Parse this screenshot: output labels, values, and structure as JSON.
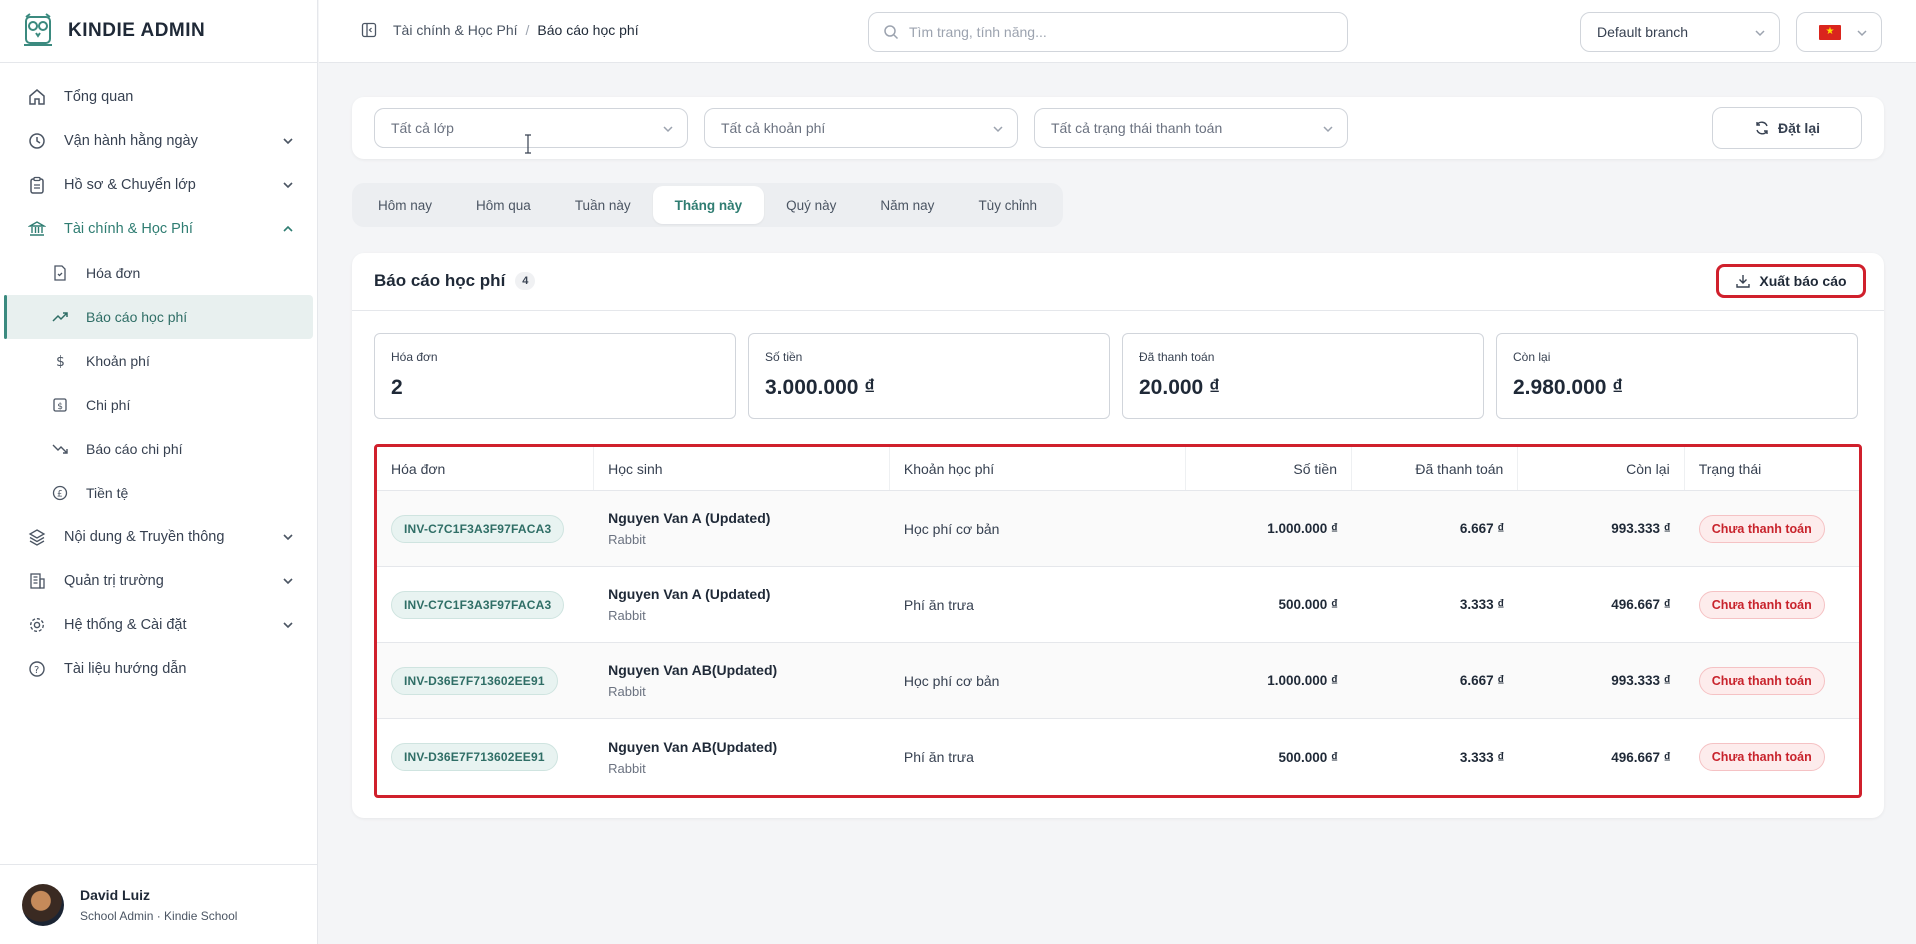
{
  "brand": {
    "name": "KINDIE ADMIN",
    "logo_icon": "owl-logo-icon",
    "accent": "#3b8a7f"
  },
  "sidebar": {
    "items": [
      {
        "label": "Tổng quan",
        "icon": "home-icon"
      },
      {
        "label": "Vận hành hằng ngày",
        "icon": "clock-icon",
        "expandable": true
      },
      {
        "label": "Hồ sơ & Chuyển lớp",
        "icon": "clipboard-icon",
        "expandable": true
      },
      {
        "label": "Tài chính & Học Phí",
        "icon": "bank-icon",
        "expanded": true,
        "children": [
          {
            "label": "Hóa đơn",
            "icon": "invoice-icon"
          },
          {
            "label": "Báo cáo học phí",
            "icon": "trending-up-icon",
            "active": true
          },
          {
            "label": "Khoản phí",
            "icon": "dollar-icon"
          },
          {
            "label": "Chi phí",
            "icon": "receipt-icon"
          },
          {
            "label": "Báo cáo chi phí",
            "icon": "trending-down-icon"
          },
          {
            "label": "Tiền tệ",
            "icon": "currency-icon"
          }
        ]
      },
      {
        "label": "Nội dung & Truyền thông",
        "icon": "layers-icon",
        "expandable": true
      },
      {
        "label": "Quản trị trường",
        "icon": "building-icon",
        "expandable": true
      },
      {
        "label": "Hệ thống & Cài đặt",
        "icon": "gear-icon",
        "expandable": true
      },
      {
        "label": "Tài liệu hướng dẫn",
        "icon": "help-icon"
      }
    ]
  },
  "user": {
    "name": "David Luiz",
    "role": "School Admin · Kindie School"
  },
  "topbar": {
    "breadcrumb": [
      "Tài chính & Học Phí",
      "Báo cáo học phí"
    ],
    "search_placeholder": "Tìm trang, tính năng...",
    "branch": "Default branch",
    "language_flag": "vietnam-flag-icon"
  },
  "filters": {
    "class": "Tất cả lớp",
    "fee": "Tất cả khoản phí",
    "payment_status": "Tất cả trạng thái thanh toán",
    "reset_label": "Đặt lại"
  },
  "periods": {
    "options": [
      "Hôm nay",
      "Hôm qua",
      "Tuần này",
      "Tháng này",
      "Quý này",
      "Năm nay",
      "Tùy chỉnh"
    ],
    "selected": "Tháng này"
  },
  "report": {
    "title": "Báo cáo học phí",
    "count": "4",
    "export_label": "Xuất báo cáo",
    "stats": [
      {
        "label": "Hóa đơn",
        "value": "2"
      },
      {
        "label": "Số tiền",
        "value": "3.000.000 ₫"
      },
      {
        "label": "Đã thanh toán",
        "value": "20.000 ₫"
      },
      {
        "label": "Còn lại",
        "value": "2.980.000 ₫"
      }
    ],
    "columns": [
      "Hóa đơn",
      "Học sinh",
      "Khoản học phí",
      "Số tiền",
      "Đã thanh toán",
      "Còn lại",
      "Trạng thái"
    ],
    "rows": [
      {
        "invoice": "INV-C7C1F3A3F97FACA3",
        "student": "Nguyen Van A (Updated)",
        "class": "Rabbit",
        "fee": "Học phí cơ bản",
        "amount": "1.000.000 ₫",
        "paid": "6.667 ₫",
        "remaining": "993.333 ₫",
        "status": "Chưa thanh toán"
      },
      {
        "invoice": "INV-C7C1F3A3F97FACA3",
        "student": "Nguyen Van A (Updated)",
        "class": "Rabbit",
        "fee": "Phí ăn trưa",
        "amount": "500.000 ₫",
        "paid": "3.333 ₫",
        "remaining": "496.667 ₫",
        "status": "Chưa thanh toán"
      },
      {
        "invoice": "INV-D36E7F713602EE91",
        "student": "Nguyen Van AB(Updated)",
        "class": "Rabbit",
        "fee": "Học phí cơ bản",
        "amount": "1.000.000 ₫",
        "paid": "6.667 ₫",
        "remaining": "993.333 ₫",
        "status": "Chưa thanh toán"
      },
      {
        "invoice": "INV-D36E7F713602EE91",
        "student": "Nguyen Van AB(Updated)",
        "class": "Rabbit",
        "fee": "Phí ăn trưa",
        "amount": "500.000 ₫",
        "paid": "3.333 ₫",
        "remaining": "496.667 ₫",
        "status": "Chưa thanh toán"
      }
    ]
  },
  "colors": {
    "highlight_outline": "#d0202c",
    "status_unpaid": "#c8232c",
    "active_tab": "#2f7d72"
  }
}
